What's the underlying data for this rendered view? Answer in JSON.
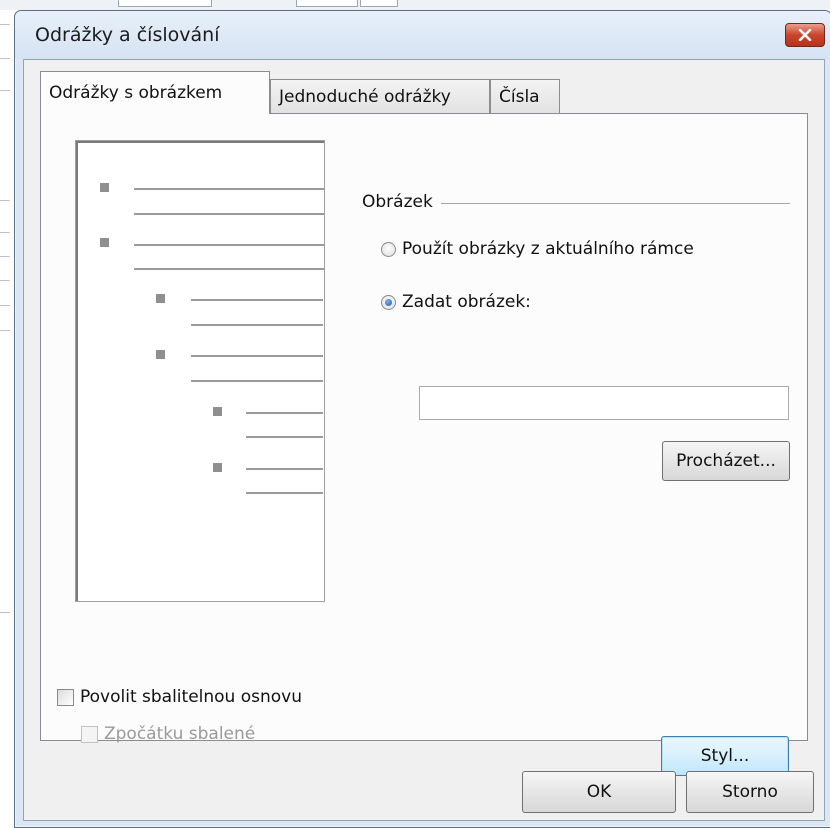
{
  "dialog": {
    "title": "Odrážky a číslování",
    "close_icon": "close-icon"
  },
  "tabs": [
    {
      "label": "Odrážky s obrázkem",
      "active": true
    },
    {
      "label": "Jednoduché odrážky",
      "active": false
    },
    {
      "label": "Čísla",
      "active": false
    }
  ],
  "picture_group": {
    "label": "Obrázek",
    "option_current_frame": "Použít obrázky z aktuálního rámce",
    "option_custom": "Zadat obrázek:",
    "selected": "custom",
    "image_path_value": "",
    "browse_label": "Procházet..."
  },
  "collapsible": {
    "enable_label": "Povolit sbalitelnou osnovu",
    "enable_checked": false,
    "initially_collapsed_label": "Zpočátku sbalené",
    "initially_collapsed_enabled": false
  },
  "style_button_label": "Styl...",
  "ok_label": "OK",
  "cancel_label": "Storno",
  "colors": {
    "dialog_frame": "#dbe7f4",
    "close_button": "#c9452c",
    "radio_selected": "#1c5cae"
  }
}
